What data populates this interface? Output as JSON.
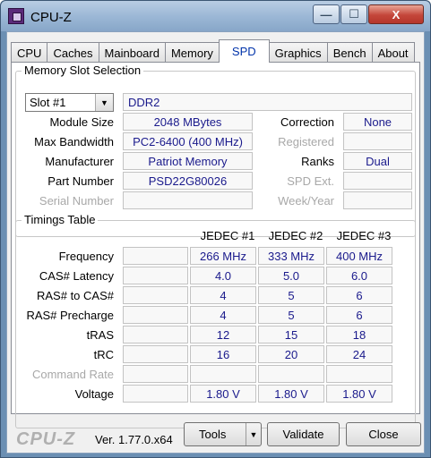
{
  "window": {
    "title": "CPU-Z",
    "min_glyph": "—",
    "max_glyph": "☐",
    "close_glyph": "X"
  },
  "tabs": [
    "CPU",
    "Caches",
    "Mainboard",
    "Memory",
    "SPD",
    "Graphics",
    "Bench",
    "About"
  ],
  "active_tab": "SPD",
  "memory_slot": {
    "group_title": "Memory Slot Selection",
    "slot_value": "Slot #1",
    "memory_type": "DDR2",
    "module_size_label": "Module Size",
    "module_size": "2048 MBytes",
    "max_bandwidth_label": "Max Bandwidth",
    "max_bandwidth": "PC2-6400 (400 MHz)",
    "manufacturer_label": "Manufacturer",
    "manufacturer": "Patriot Memory",
    "part_number_label": "Part Number",
    "part_number": "PSD22G80026",
    "serial_number_label": "Serial Number",
    "serial_number": "",
    "correction_label": "Correction",
    "correction": "None",
    "registered_label": "Registered",
    "registered": "",
    "ranks_label": "Ranks",
    "ranks": "Dual",
    "spd_ext_label": "SPD Ext.",
    "spd_ext": "",
    "week_year_label": "Week/Year",
    "week_year": ""
  },
  "timings": {
    "group_title": "Timings Table",
    "columns": [
      "JEDEC #1",
      "JEDEC #2",
      "JEDEC #3"
    ],
    "rows": [
      {
        "label": "Frequency",
        "dim": false,
        "values": [
          "266 MHz",
          "333 MHz",
          "400 MHz"
        ]
      },
      {
        "label": "CAS# Latency",
        "dim": false,
        "values": [
          "4.0",
          "5.0",
          "6.0"
        ]
      },
      {
        "label": "RAS# to CAS#",
        "dim": false,
        "values": [
          "4",
          "5",
          "6"
        ]
      },
      {
        "label": "RAS# Precharge",
        "dim": false,
        "values": [
          "4",
          "5",
          "6"
        ]
      },
      {
        "label": "tRAS",
        "dim": false,
        "values": [
          "12",
          "15",
          "18"
        ]
      },
      {
        "label": "tRC",
        "dim": false,
        "values": [
          "16",
          "20",
          "24"
        ]
      },
      {
        "label": "Command Rate",
        "dim": true,
        "values": [
          "",
          "",
          ""
        ]
      },
      {
        "label": "Voltage",
        "dim": false,
        "values": [
          "1.80 V",
          "1.80 V",
          "1.80 V"
        ]
      }
    ]
  },
  "footer": {
    "logo": "CPU-Z",
    "version": "Ver. 1.77.0.x64",
    "tools": "Tools",
    "validate": "Validate",
    "close": "Close"
  }
}
